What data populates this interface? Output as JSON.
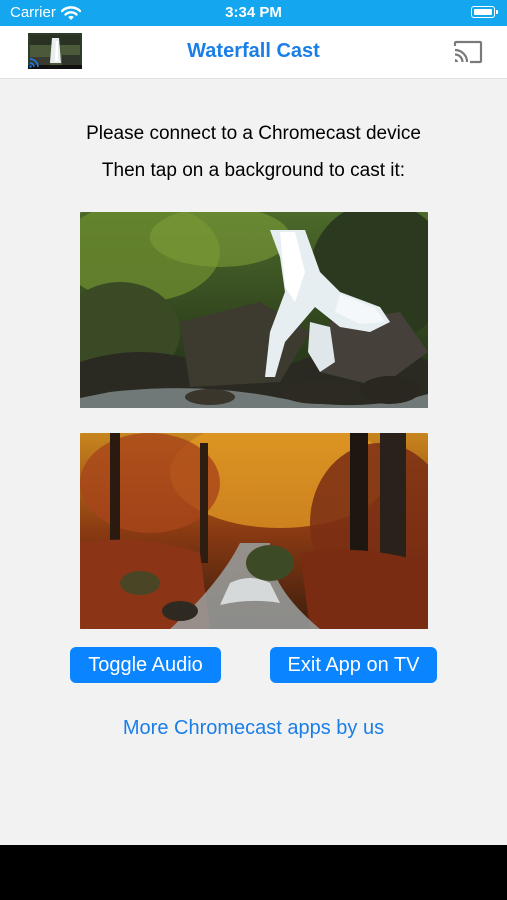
{
  "status_bar": {
    "carrier": "Carrier",
    "time": "3:34 PM",
    "icons": [
      "wifi-icon",
      "battery-icon"
    ]
  },
  "nav": {
    "title": "Waterfall Cast",
    "logo_icon": "app-logo-icon",
    "cast_icon": "cast-icon"
  },
  "instructions": {
    "line1": "Please connect to a Chromecast device",
    "line2": "Then tap on a background to cast it:"
  },
  "backgrounds": [
    {
      "name": "waterfall-background",
      "icon": "waterfall-image"
    },
    {
      "name": "autumn-forest-background",
      "icon": "autumn-stream-image"
    }
  ],
  "buttons": {
    "toggle_audio": "Toggle Audio",
    "exit_app": "Exit App on TV"
  },
  "more_link": "More Chromecast apps by us",
  "colors": {
    "status_bar": "#14a6ee",
    "accent": "#1a7ee8",
    "button": "#0a84ff",
    "background": "#f2f2f2"
  }
}
